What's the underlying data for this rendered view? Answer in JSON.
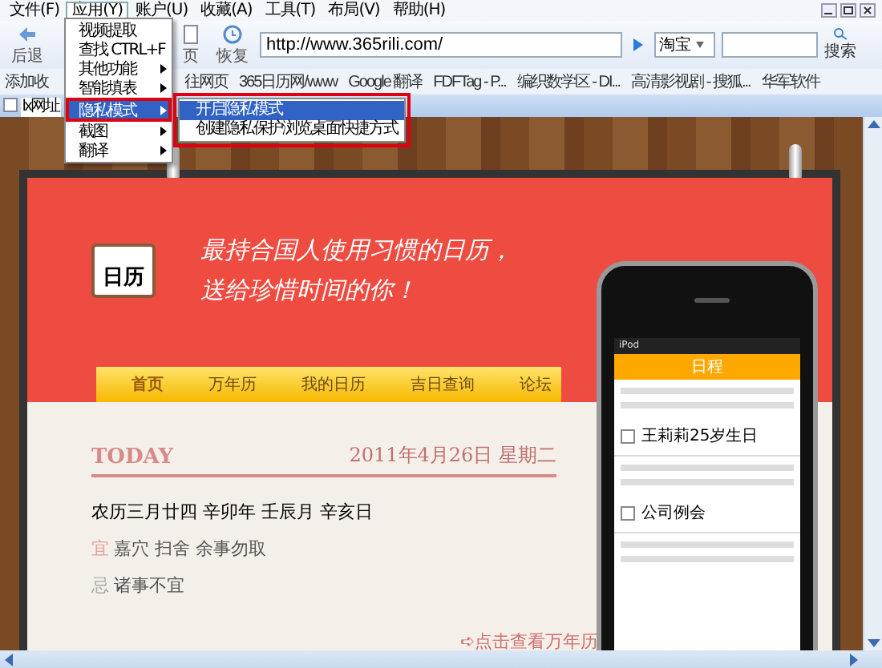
{
  "menu_bar": [
    {
      "label": "文件(F)",
      "selected": false
    },
    {
      "label": "应用(Y)",
      "selected": true
    },
    {
      "label": "账户(U)",
      "selected": false
    },
    {
      "label": "收藏(A)",
      "selected": false
    },
    {
      "label": "工具(T)",
      "selected": false
    },
    {
      "label": "布局(V)",
      "selected": false
    },
    {
      "label": "帮助(H)",
      "selected": false
    }
  ],
  "toolbar": {
    "buttons": [
      {
        "label": "后退",
        "kind": "back"
      },
      {
        "label": "页",
        "kind": "page"
      },
      {
        "label": "恢复",
        "kind": "restore"
      }
    ],
    "address": "http://www.365rili.com/",
    "search_engine": "淘宝",
    "search_button": "搜索"
  },
  "bookmarks": [
    "添加收",
    "往网页",
    "365日历网/www",
    "Google 翻译",
    "FDFTag - P...",
    "编织数学区 - DI...",
    "高清影视剧 - 搜狐...",
    "华军软件"
  ],
  "tab": {
    "label": "lx网址",
    "checked": false
  },
  "menu": {
    "items": [
      {
        "label": "视频提取",
        "submenu": false,
        "selected": false
      },
      {
        "label": "查找 CTRL+F",
        "submenu": false,
        "selected": false
      },
      {
        "label": "其他功能",
        "submenu": true,
        "selected": false
      },
      {
        "label": "智能填表",
        "submenu": true,
        "selected": false
      },
      {
        "label": "隐私模式",
        "submenu": true,
        "selected": true
      },
      {
        "label": "截图",
        "submenu": true,
        "selected": false
      },
      {
        "label": "翻译",
        "submenu": true,
        "selected": false
      }
    ]
  },
  "submenu": {
    "items": [
      {
        "label": "开启隐私模式",
        "selected": true
      },
      {
        "label": "创建隐私保护浏览桌面快捷方式",
        "selected": false
      }
    ]
  },
  "page": {
    "logo_text": "日历",
    "slogan": [
      "最持合国人使用习惯的日历，",
      "送给珍惜时间的你！"
    ],
    "nav": [
      {
        "label": "首页",
        "selected": true
      },
      {
        "label": "万年历",
        "selected": false
      },
      {
        "label": "我的日历",
        "selected": false
      },
      {
        "label": "吉日查询",
        "selected": false
      },
      {
        "label": "论坛",
        "selected": false
      }
    ],
    "today_label": "TODAY",
    "date": "2011年4月26日 星期二",
    "lunar": "农历三月廿四 辛卯年 壬辰月 辛亥日",
    "good": {
      "mark": "宜",
      "text": "嘉穴 扫舍 余事勿取"
    },
    "bad": {
      "mark": "忌",
      "text": "诸事不宜"
    },
    "more_link": "➪点击查看万年历",
    "phone": {
      "carrier": "iPod",
      "title": "日程",
      "events": [
        {
          "text": "王莉莉25岁生日",
          "checked": false
        },
        {
          "text": "公司例会",
          "checked": false
        }
      ]
    }
  }
}
